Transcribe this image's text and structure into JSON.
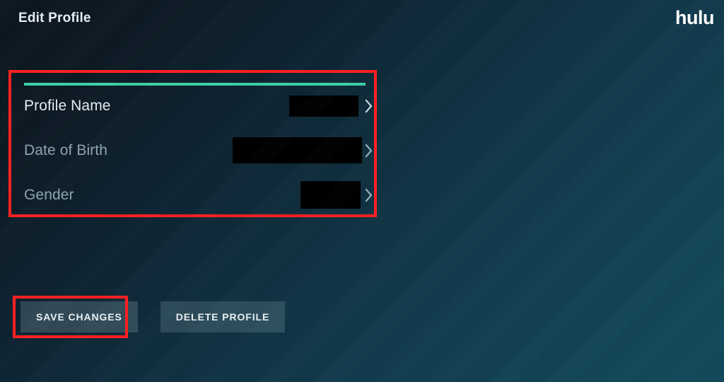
{
  "header": {
    "title": "Edit Profile",
    "brand": "hulu"
  },
  "colors": {
    "accent_teal": "#3ccfa6",
    "highlight_red": "#fe2020",
    "background_start": "#0c1720",
    "background_end": "#13495b",
    "label_active": "#e4edf1",
    "label_inactive": "#8fa4ae"
  },
  "form": {
    "fields": [
      {
        "label": "Profile Name",
        "value": "",
        "redacted": true,
        "active": true,
        "chevron": "chevron-right-icon"
      },
      {
        "label": "Date of Birth",
        "value": "",
        "redacted": true,
        "active": false,
        "chevron": "chevron-right-icon"
      },
      {
        "label": "Gender",
        "value": "",
        "redacted": true,
        "active": false,
        "chevron": "chevron-right-icon"
      }
    ]
  },
  "actions": {
    "save_label": "SAVE CHANGES",
    "delete_label": "DELETE PROFILE"
  }
}
